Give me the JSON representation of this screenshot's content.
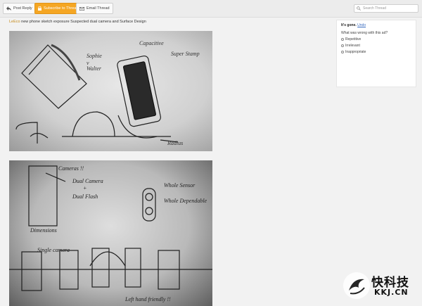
{
  "toolbar": {
    "post_reply": "Post Reply",
    "subscribe": "Subscribe to Thread",
    "email": "Email Thread",
    "search_placeholder": "Search Thread"
  },
  "headline": {
    "brand": "LeEco",
    "text": " new phone sketch exposure Suspected dual camera and Surface Design"
  },
  "ad_feedback": {
    "gone": "It's gone.",
    "undo": "Undo",
    "question": "What was wrong with this ad?",
    "options": [
      "Repetitive",
      "Irrelevant",
      "Inappropriate"
    ]
  },
  "watermark": {
    "cn": "快科技",
    "domain": "KKJ.CN"
  },
  "colors": {
    "accent": "#f5a623",
    "link": "#3a6cc0"
  }
}
